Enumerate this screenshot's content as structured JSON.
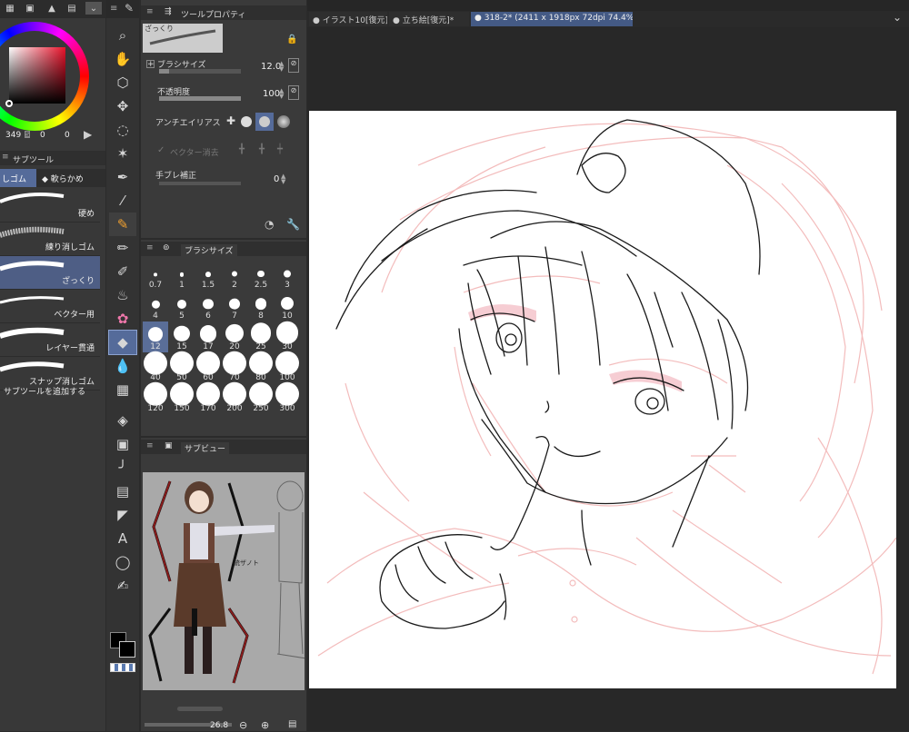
{
  "colors": {
    "accent": "#556b9a",
    "panel": "#3a3a3a",
    "canvas_bg": "#282828",
    "selected_tool": "#f0a030",
    "sketch_red": "#f2b5b5"
  },
  "color_wheel": {
    "values": [
      "349",
      "0",
      "0"
    ],
    "hue_label": "S"
  },
  "subtool_panel": {
    "title": "サブツール",
    "tabs": [
      "しゴム",
      "軟らかめ"
    ],
    "items": [
      "硬め",
      "練り消しゴム",
      "ざっくり",
      "ベクター用",
      "レイヤー貫通",
      "スナップ消しゴム"
    ],
    "selected_index": 2,
    "add_label": "サブツールを追加する"
  },
  "tool_property": {
    "title": "ツールプロパティ",
    "preset_name": "ざっくり",
    "brush_size_label": "ブラシサイズ",
    "brush_size_value": "12.0",
    "brush_size_fill": 0.12,
    "opacity_label": "不透明度",
    "opacity_value": "100",
    "opacity_fill": 1.0,
    "antialias_label": "アンチエイリアス",
    "vector_erase_label": "ベクター消去",
    "stabilize_label": "手ブレ補正",
    "stabilize_value": "0"
  },
  "brush_size_panel": {
    "title": "ブラシサイズ",
    "sizes": [
      "0.7",
      "1",
      "1.5",
      "2",
      "2.5",
      "3",
      "4",
      "5",
      "6",
      "7",
      "8",
      "10",
      "12",
      "15",
      "17",
      "20",
      "25",
      "30",
      "40",
      "50",
      "60",
      "70",
      "80",
      "100",
      "120",
      "150",
      "170",
      "200",
      "250",
      "300"
    ],
    "selected": "12"
  },
  "sub_view": {
    "title": "サブビュー",
    "zoom_value": "26.8",
    "note_text": "統ザノト"
  },
  "canvas_tabs": [
    {
      "label": "イラスト10[復元]",
      "active": false
    },
    {
      "label": "立ち絵[復元]*",
      "active": false
    },
    {
      "label": "318-2* (2411 x 1918px 72dpi 74.4%)",
      "active": true
    }
  ],
  "icons": {
    "zoom": "magnifier-icon",
    "hand": "hand-icon",
    "rotate": "rotate-icon",
    "move": "move-icon",
    "lasso": "lasso-icon",
    "wand": "magic-wand-icon",
    "pen": "pen-icon",
    "eyedropper": "eyedropper-icon"
  }
}
